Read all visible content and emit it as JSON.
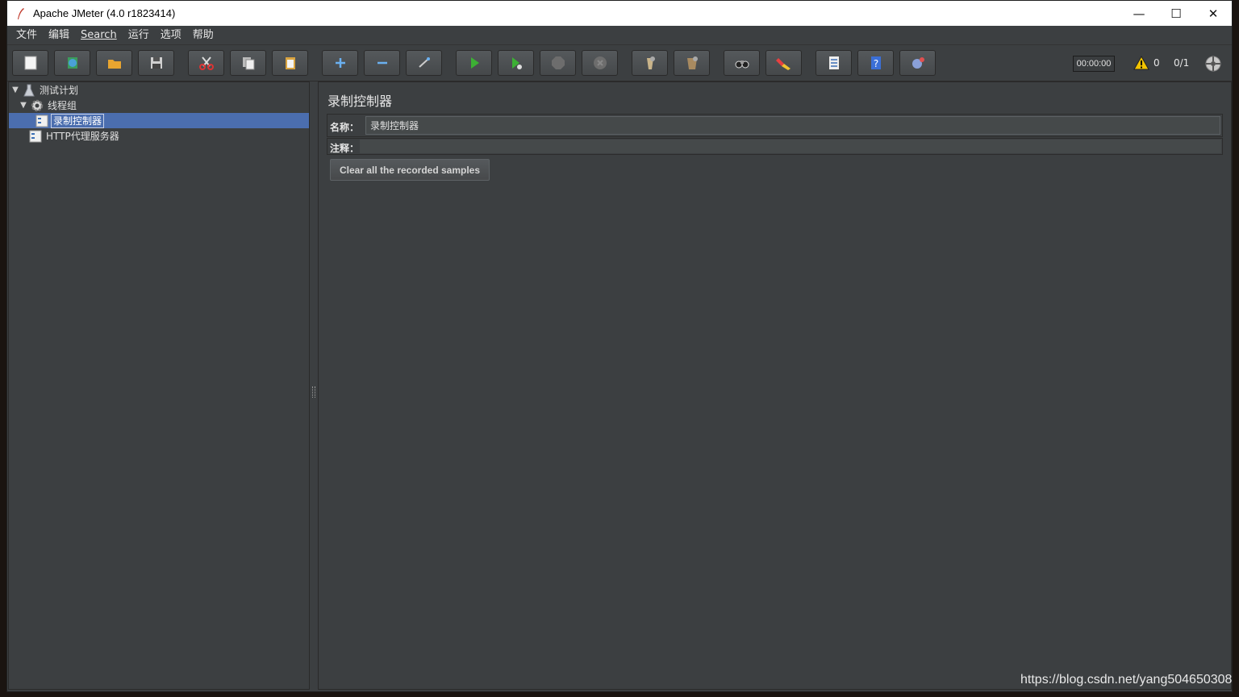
{
  "window": {
    "title": "Apache JMeter (4.0 r1823414)",
    "minimize": "—",
    "maximize": "☐",
    "close": "✕"
  },
  "menu": [
    "文件",
    "编辑",
    "Search",
    "运行",
    "选项",
    "帮助"
  ],
  "toolbar": {
    "buttons": [
      {
        "name": "new-icon"
      },
      {
        "name": "templates-icon"
      },
      {
        "name": "open-icon"
      },
      {
        "name": "save-icon"
      },
      {
        "name": "cut-icon"
      },
      {
        "name": "copy-icon"
      },
      {
        "name": "paste-icon"
      },
      {
        "name": "expand-icon"
      },
      {
        "name": "collapse-icon"
      },
      {
        "name": "toggle-icon"
      },
      {
        "name": "start-icon"
      },
      {
        "name": "start-no-pause-icon"
      },
      {
        "name": "stop-icon"
      },
      {
        "name": "shutdown-icon"
      },
      {
        "name": "clear-icon"
      },
      {
        "name": "clear-all-icon"
      },
      {
        "name": "search-icon"
      },
      {
        "name": "reset-search-icon"
      },
      {
        "name": "function-helper-icon"
      },
      {
        "name": "help-icon"
      },
      {
        "name": "remote-icon"
      }
    ],
    "timer": "00:00:00",
    "warnings": "0",
    "threads": "0/1"
  },
  "tree": {
    "test_plan": "测试计划",
    "thread_group": "线程组",
    "recording_controller": "录制控制器",
    "http_proxy": "HTTP代理服务器"
  },
  "panel": {
    "title": "录制控制器",
    "name_label": "名称：",
    "name_value": "录制控制器",
    "comment_label": "注释：",
    "comment_value": "",
    "clear_button": "Clear all the recorded samples"
  },
  "watermark": "https://blog.csdn.net/yang504650308",
  "colors": {
    "background": "#3c3f41",
    "selection": "#4b6eaf",
    "start_green": "#3cb034"
  }
}
